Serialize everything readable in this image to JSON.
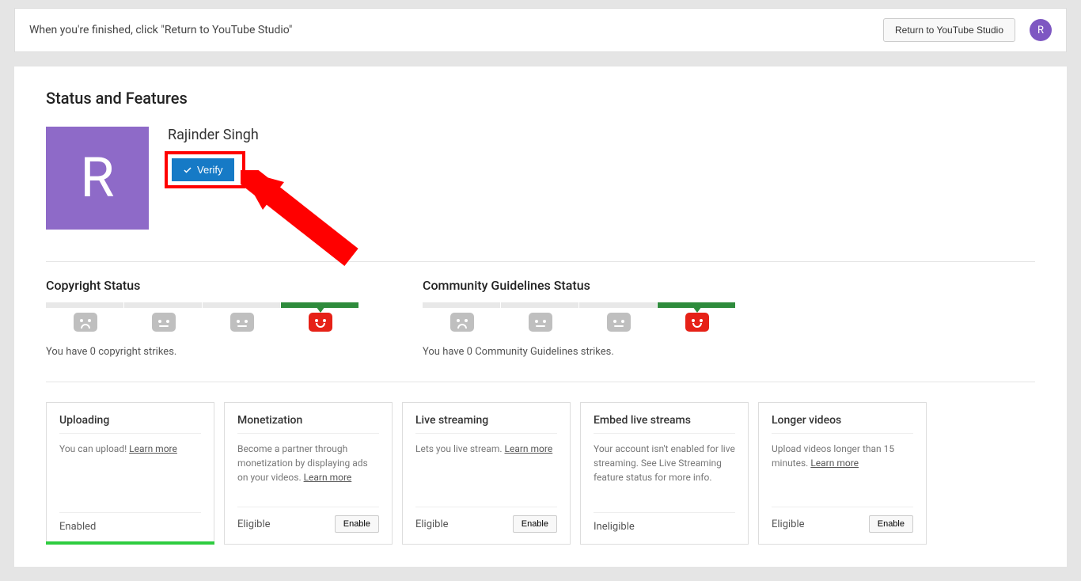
{
  "topBar": {
    "message": "When you're finished, click \"Return to YouTube Studio\"",
    "returnButton": "Return to YouTube Studio",
    "avatarLetter": "R"
  },
  "pageTitle": "Status and Features",
  "profile": {
    "avatarLetter": "R",
    "channelName": "Rajinder Singh",
    "verifyLabel": "Verify"
  },
  "copyright": {
    "title": "Copyright Status",
    "text": "You have 0 copyright strikes."
  },
  "community": {
    "title": "Community Guidelines Status",
    "text": "You have 0 Community Guidelines strikes."
  },
  "cards": {
    "uploading": {
      "title": "Uploading",
      "desc": "You can upload! ",
      "link": "Learn more",
      "status": "Enabled"
    },
    "monetization": {
      "title": "Monetization",
      "desc": "Become a partner through monetization by displaying ads on your videos. ",
      "link": "Learn more",
      "status": "Eligible",
      "action": "Enable"
    },
    "live": {
      "title": "Live streaming",
      "desc": "Lets you live stream. ",
      "link": "Learn more",
      "status": "Eligible",
      "action": "Enable"
    },
    "embed": {
      "title": "Embed live streams",
      "desc": "Your account isn't enabled for live streaming. See Live Streaming feature status for more info.",
      "status": "Ineligible"
    },
    "longer": {
      "title": "Longer videos",
      "desc": "Upload videos longer than 15 minutes. ",
      "link": "Learn more",
      "status": "Eligible",
      "action": "Enable"
    }
  }
}
